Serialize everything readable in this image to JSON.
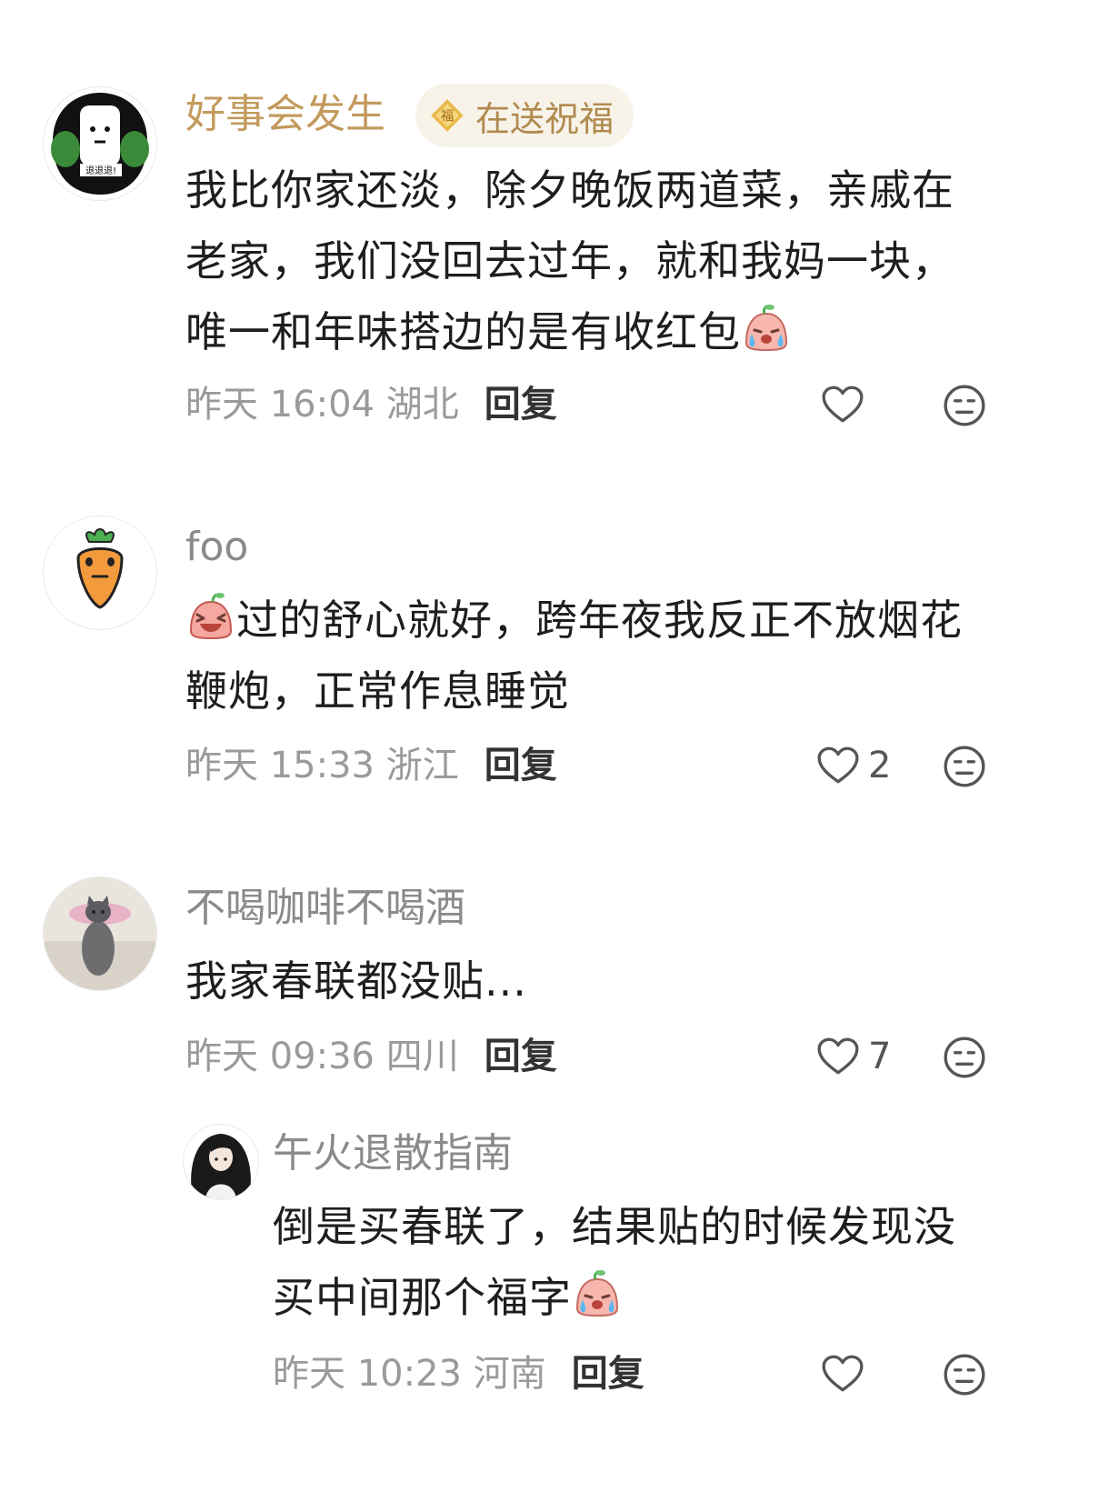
{
  "comments": [
    {
      "username": "好事会发生",
      "badge": "在送祝福",
      "content_lines": [
        "我比你家还淡，除夕晚饭两道菜，亲戚在",
        "老家，我们没回去过年，就和我妈一块，",
        "唯一和年味搭边的是有收红包"
      ],
      "time": "昨天 16:04 湖北",
      "reply_label": "回复",
      "likes": ""
    },
    {
      "username": "foo",
      "content_lines": [
        "过的舒心就好，跨年夜我反正不放烟花",
        "鞭炮，正常作息睡觉"
      ],
      "time": "昨天 15:33 浙江",
      "reply_label": "回复",
      "likes": "2"
    },
    {
      "username": "不喝咖啡不喝酒",
      "content_lines": [
        "我家春联都没贴..."
      ],
      "time": "昨天 09:36 四川",
      "reply_label": "回复",
      "likes": "7"
    },
    {
      "username": "午火退散指南",
      "content_lines": [
        "倒是买春联了，结果贴的时候发现没",
        "买中间那个福字"
      ],
      "time": "昨天 10:23 河南",
      "reply_label": "回复",
      "likes": ""
    }
  ],
  "colors": {
    "vip_name": "#c29a5c",
    "normal_name": "#8a8a8a",
    "badge_bg": "#f8f3e9",
    "meta": "#9a9a9a"
  },
  "icons": {
    "badge": "fu-diamond-icon",
    "like": "heart-outline-icon",
    "react": "neutral-face-icon",
    "emoji_cry": "crying-face-emoji",
    "emoji_laugh": "laughing-face-emoji"
  }
}
